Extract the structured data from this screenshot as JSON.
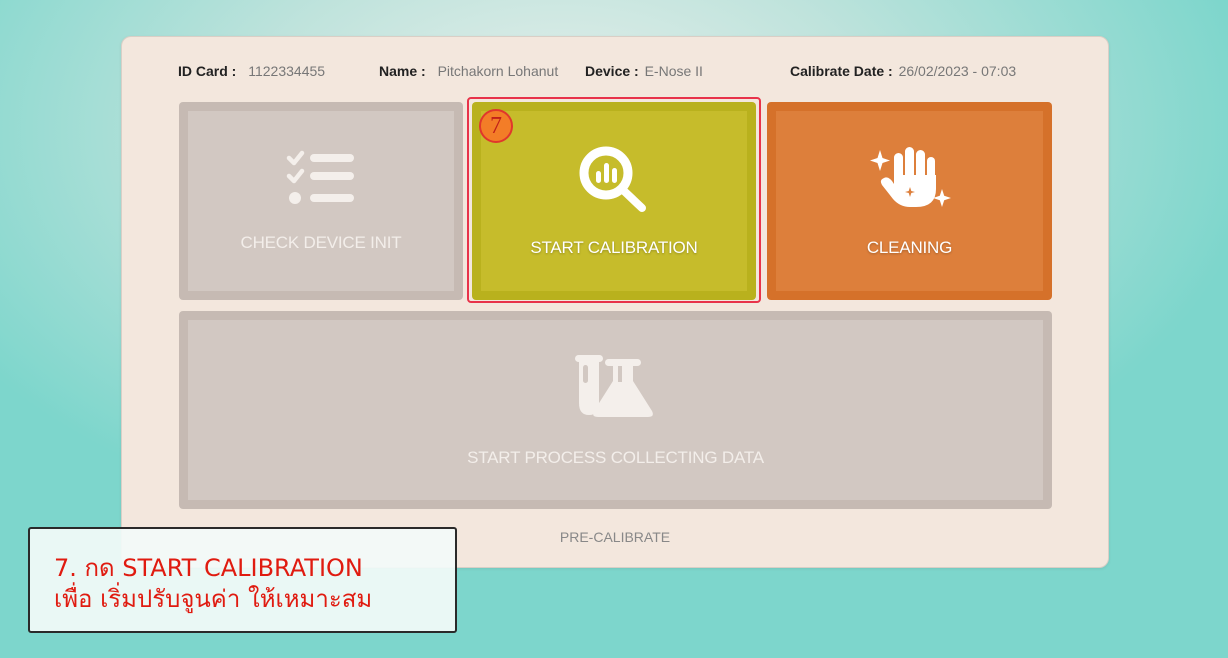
{
  "header": {
    "id_card_label": "ID Card :",
    "id_card_value": "1122334455",
    "name_label": "Name :",
    "name_value": "Pitchakorn Lohanut",
    "device_label": "Device :",
    "device_value": "E-Nose II",
    "calibrate_label": "Calibrate Date :",
    "calibrate_value": "26/02/2023 - 07:03"
  },
  "tiles": {
    "check_device": {
      "label": "CHECK DEVICE INIT",
      "icon": "checklist-icon",
      "color": "#d2c8c2"
    },
    "start_calibration": {
      "label": "START CALIBRATION",
      "icon": "search-chart-icon",
      "color": "#c6bc2b"
    },
    "cleaning": {
      "label": "CLEANING",
      "icon": "clean-hand-sparkle-icon",
      "color": "#dd7f3b"
    },
    "collect_data": {
      "label": "START PROCESS COLLECTING DATA",
      "icon": "lab-flask-icon",
      "color": "#d2c8c2"
    }
  },
  "step_badge": "7",
  "footer_text": "PRE-CALIBRATE",
  "callout": {
    "line1": "7. กด START CALIBRATION",
    "line2": "เพื่อ เริ่มปรับจูนค่า ให้เหมาะสม",
    "text_color": "#e01b10"
  },
  "colors": {
    "highlight_border": "#e8334a",
    "panel_bg": "#f3e7dd"
  }
}
